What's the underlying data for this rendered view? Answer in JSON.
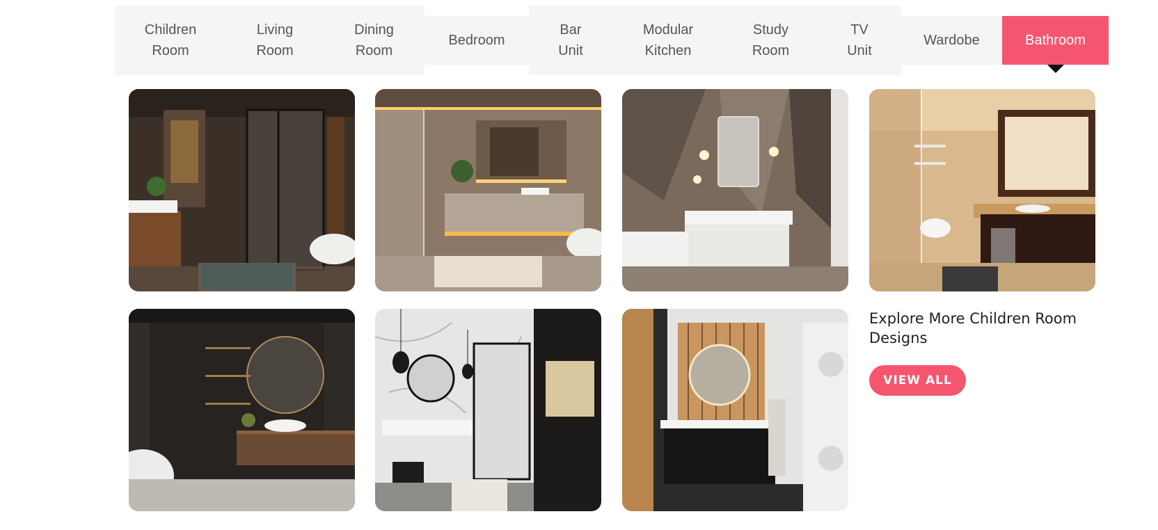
{
  "tabs": [
    {
      "label": "Children\nRoom"
    },
    {
      "label": "Living\nRoom"
    },
    {
      "label": "Dining\nRoom"
    },
    {
      "label": "Bedroom"
    },
    {
      "label": "Bar\nUnit"
    },
    {
      "label": "Modular\nKitchen"
    },
    {
      "label": "Study\nRoom"
    },
    {
      "label": "TV\nUnit"
    },
    {
      "label": "Wardobe"
    },
    {
      "label": "Bathroom"
    }
  ],
  "active_tab": "Bathroom",
  "explore": {
    "heading": "Explore More Children Room Designs",
    "button_label": "VIEW ALL"
  },
  "colors": {
    "accent": "#f5566f",
    "tab_bg": "#f5f5f5",
    "tab_text": "#555555",
    "heading_text": "#222222"
  }
}
